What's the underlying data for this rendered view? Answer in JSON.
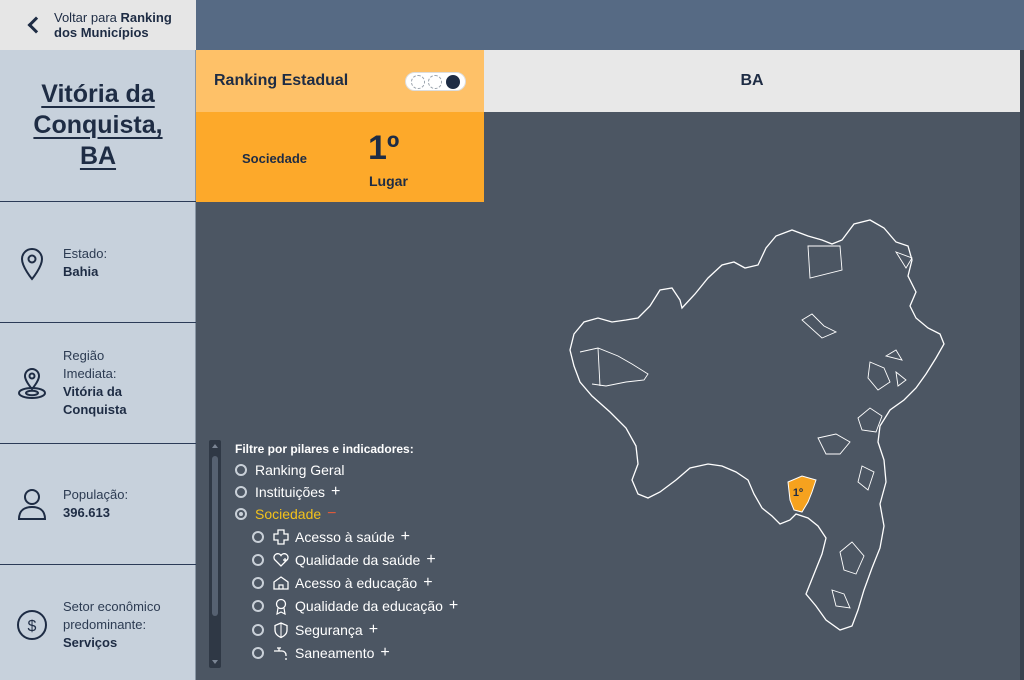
{
  "back": {
    "prefix": "Voltar para ",
    "bold1": "Ranking",
    "bold2": "dos Municípios"
  },
  "municipality": {
    "name": "Vitória da Conquista, BA"
  },
  "info_cards": [
    {
      "label": "Estado:",
      "value": "Bahia",
      "icon": "location-pin-icon"
    },
    {
      "label": "Região Imediata:",
      "value": "Vitória da Conquista",
      "icon": "region-pin-icon"
    },
    {
      "label": "População:",
      "value": "396.613",
      "icon": "person-icon"
    },
    {
      "label": "Setor econômico predominante:",
      "value": "Serviços",
      "icon": "dollar-icon"
    }
  ],
  "ranking": {
    "title": "Ranking Estadual",
    "pillar": "Sociedade",
    "position": "1º",
    "position_label": "Lugar",
    "state": "BA",
    "toggle_active": 3
  },
  "map": {
    "marker_label": "1º",
    "highlight_color": "#f6a21e",
    "outline_color": "#ffffff"
  },
  "filter": {
    "title": "Filtre por pilares e indicadores:",
    "options": [
      {
        "label": "Ranking Geral",
        "expander": ""
      },
      {
        "label": "Instituições",
        "expander": "+"
      },
      {
        "label": "Sociedade",
        "expander": "−",
        "selected": true
      },
      {
        "label": "Acesso à saúde",
        "expander": "+",
        "icon": "health-cross-icon"
      },
      {
        "label": "Qualidade da saúde",
        "expander": "+",
        "icon": "heart-health-icon"
      },
      {
        "label": "Acesso à educação",
        "expander": "+",
        "icon": "school-icon"
      },
      {
        "label": "Qualidade da educação",
        "expander": "+",
        "icon": "award-icon"
      },
      {
        "label": "Segurança",
        "expander": "+",
        "icon": "shield-icon"
      },
      {
        "label": "Saneamento",
        "expander": "+",
        "icon": "faucet-icon"
      }
    ]
  },
  "colors": {
    "accent": "#fda92a",
    "accent_light": "#fec168",
    "navy": "#1e2c44",
    "map_bg": "#4c5663",
    "sidebar": "#c7d1dc",
    "selected_text": "#f3c21b"
  }
}
